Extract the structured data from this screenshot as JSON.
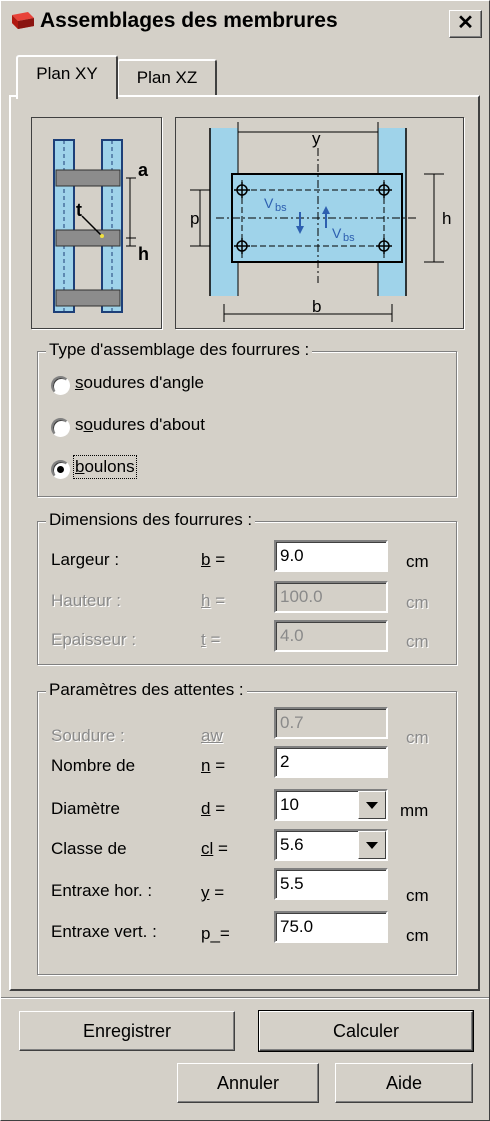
{
  "window": {
    "title": "Assemblages des membrures",
    "close_label": "✕"
  },
  "tabs": [
    {
      "label": "Plan XY",
      "active": true
    },
    {
      "label": "Plan XZ",
      "active": false
    }
  ],
  "diagram_small": {
    "label_t": "t",
    "label_a": "a",
    "label_h": "h"
  },
  "diagram_large": {
    "label_y": "y",
    "label_p": "p",
    "label_h": "h",
    "label_b": "b",
    "label_vbs": "V",
    "label_vbs_sub": "bs"
  },
  "type_group": {
    "title": "Type d'assemblage des fourrures :",
    "options": [
      {
        "first": "s",
        "rest": "oudures d'angle",
        "checked": false
      },
      {
        "first": "s",
        "u": "o",
        "rest": "udures d'about",
        "checked": false
      },
      {
        "first": "b",
        "rest": "oulons",
        "checked": true
      }
    ]
  },
  "dim_group": {
    "title": "Dimensions des fourrures :",
    "rows": [
      {
        "label": "Largeur :",
        "sym": "b",
        "eq": " =",
        "value": "9.0",
        "unit": "cm",
        "enabled": true
      },
      {
        "label": "Hauteur :",
        "sym": "h",
        "eq": " =",
        "value": "100.0",
        "unit": "cm",
        "enabled": false
      },
      {
        "label": "Epaisseur :",
        "sym": "t",
        "eq": " =",
        "value": "4.0",
        "unit": "cm",
        "enabled": false
      }
    ]
  },
  "param_group": {
    "title": "Paramètres des attentes :",
    "rows": [
      {
        "label": "Soudure :",
        "sym": "aw",
        "eq": "",
        "value": "0.7",
        "unit": "cm",
        "enabled": false,
        "combo": false
      },
      {
        "label": "Nombre de",
        "sym": "n",
        "eq": " =",
        "value": "2",
        "unit": "",
        "enabled": true,
        "combo": false
      },
      {
        "label": "Diamètre",
        "sym": "d",
        "eq": " =",
        "value": "10",
        "unit": "mm",
        "enabled": true,
        "combo": true
      },
      {
        "label": "Classe de",
        "sym": "cl",
        "eq": " =",
        "value": "5.6",
        "unit": "",
        "enabled": true,
        "combo": true
      },
      {
        "label": "Entraxe hor. :",
        "sym": "y",
        "eq": " =",
        "value": "5.5",
        "unit": "cm",
        "enabled": true,
        "combo": false
      },
      {
        "label": "Entraxe vert. :",
        "sym": "p",
        "eq": "_=",
        "value": "75.0",
        "unit": "cm",
        "enabled": true,
        "combo": false
      }
    ]
  },
  "buttons": {
    "save": "Enregistrer",
    "calc": "Calculer",
    "cancel": "Annuler",
    "help": "Aide"
  },
  "colors": {
    "face": "#d4d0c8",
    "steel_fill": "#9fd3ea",
    "steel_dark": "#1d3f78",
    "arrow_blue": "#2d5fb0"
  }
}
